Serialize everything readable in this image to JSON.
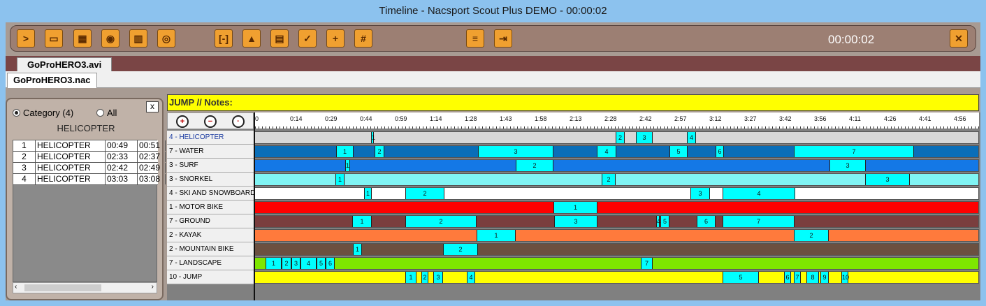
{
  "window": {
    "title": "Timeline - Nacsport Scout Plus DEMO - 00:00:02"
  },
  "toolbar": {
    "buttons": [
      {
        "name": "play-icon",
        "glyph": ">"
      },
      {
        "name": "monitor-icon",
        "glyph": "▭"
      },
      {
        "name": "clapper-icon",
        "glyph": "▦"
      },
      {
        "name": "camera-icon",
        "glyph": "◉"
      },
      {
        "name": "film-icon",
        "glyph": "▥"
      },
      {
        "name": "eye-icon",
        "glyph": "◎"
      },
      {
        "name": "bracket-icon",
        "glyph": "[-]"
      },
      {
        "name": "export-icon",
        "glyph": "▲"
      },
      {
        "name": "trash-icon",
        "glyph": "▤"
      },
      {
        "name": "checklist-icon",
        "glyph": "✓"
      },
      {
        "name": "add-icon",
        "glyph": "+"
      },
      {
        "name": "grid-icon",
        "glyph": "#"
      },
      {
        "name": "settings-list-icon",
        "glyph": "≡"
      },
      {
        "name": "import-icon",
        "glyph": "⇥"
      },
      {
        "name": "close-icon",
        "glyph": "✕"
      }
    ],
    "clock": "00:00:02"
  },
  "tabs": {
    "video": "GoProHERO3.avi",
    "project": "GoProHERO3.nac"
  },
  "left_panel": {
    "radio_category": "Category (4)",
    "radio_all": "All",
    "close": "x",
    "title": "HELICOPTER",
    "rows": [
      [
        "1",
        "HELICOPTER",
        "00:49",
        "00:51"
      ],
      [
        "2",
        "HELICOPTER",
        "02:33",
        "02:37"
      ],
      [
        "3",
        "HELICOPTER",
        "02:42",
        "02:49"
      ],
      [
        "4",
        "HELICOPTER",
        "03:03",
        "03:08"
      ]
    ]
  },
  "notes": "JUMP // Notes:",
  "ruler": {
    "labels": [
      "0",
      "0:14",
      "0:29",
      "0:44",
      "0:59",
      "1:14",
      "1:28",
      "1:43",
      "1:58",
      "2:13",
      "2:28",
      "2:42",
      "2:57",
      "3:12",
      "3:27",
      "3:42",
      "3:56",
      "4:11",
      "4:26",
      "4:41",
      "4:56"
    ]
  },
  "timeline": {
    "rows": [
      {
        "label": "4 - HELICOPTER",
        "base": "#d8d8d8",
        "labelColor": "#1a3aa0",
        "segs": [
          [
            167,
            171,
            "1"
          ],
          [
            517,
            530,
            "2"
          ],
          [
            546,
            570,
            "3"
          ],
          [
            619,
            632,
            "4"
          ]
        ]
      },
      {
        "label": "7 - WATER",
        "base": "#0a6eb8",
        "segs": [
          [
            117,
            142,
            "1"
          ],
          [
            172,
            186,
            "2"
          ],
          [
            320,
            428,
            "3"
          ],
          [
            490,
            518,
            "4"
          ],
          [
            594,
            620,
            "5"
          ],
          [
            660,
            672,
            "6"
          ],
          [
            772,
            944,
            "7"
          ]
        ]
      },
      {
        "label": "3 - SURF",
        "base": "#1478e6",
        "segs": [
          [
            130,
            137,
            "1"
          ],
          [
            374,
            428,
            "2"
          ],
          [
            823,
            875,
            "3"
          ]
        ]
      },
      {
        "label": "3 - SNORKEL",
        "base": "#80f4f4",
        "segs": [
          [
            116,
            129,
            "1"
          ],
          [
            497,
            517,
            "2"
          ],
          [
            874,
            938,
            "3"
          ]
        ]
      },
      {
        "label": "4 - SKI AND SNOWBOARD",
        "base": "#ffffff",
        "segs": [
          [
            157,
            168,
            "1"
          ],
          [
            216,
            272,
            "2"
          ],
          [
            624,
            652,
            "3"
          ],
          [
            670,
            774,
            "4"
          ]
        ]
      },
      {
        "label": "1 - MOTOR BIKE",
        "base": "#ff0000",
        "segs": [
          [
            428,
            491,
            "1"
          ]
        ]
      },
      {
        "label": "7 - GROUND",
        "base": "#7a3e3e",
        "segs": [
          [
            140,
            168,
            "1"
          ],
          [
            216,
            318,
            "2"
          ],
          [
            429,
            491,
            "3"
          ],
          [
            575,
            580,
            "4"
          ],
          [
            581,
            594,
            "5"
          ],
          [
            633,
            660,
            "6"
          ],
          [
            670,
            773,
            "7"
          ]
        ]
      },
      {
        "label": "2 - KAYAK",
        "base": "#ff7a3c",
        "segs": [
          [
            318,
            374,
            "1"
          ],
          [
            772,
            822,
            "2"
          ]
        ]
      },
      {
        "label": "2 - MOUNTAIN BIKE",
        "base": "#6b5040",
        "segs": [
          [
            141,
            154,
            "1"
          ],
          [
            270,
            320,
            "2"
          ]
        ]
      },
      {
        "label": "7 - LANDSCAPE",
        "base": "#7ee600",
        "segs": [
          [
            16,
            39,
            "1"
          ],
          [
            39,
            53,
            "2"
          ],
          [
            53,
            66,
            "3"
          ],
          [
            66,
            89,
            "4"
          ],
          [
            89,
            102,
            "5"
          ],
          [
            102,
            115,
            "6"
          ],
          [
            553,
            570,
            "7"
          ]
        ]
      },
      {
        "label": "10 - JUMP",
        "base": "#ffff00",
        "segs": [
          [
            216,
            232,
            "1"
          ],
          [
            239,
            249,
            "2"
          ],
          [
            256,
            270,
            "3"
          ],
          [
            304,
            316,
            "4"
          ],
          [
            670,
            722,
            "5"
          ],
          [
            758,
            768,
            "6"
          ],
          [
            772,
            782,
            "7"
          ],
          [
            790,
            808,
            "8"
          ],
          [
            810,
            822,
            "9"
          ],
          [
            840,
            850,
            "10"
          ]
        ]
      }
    ]
  }
}
